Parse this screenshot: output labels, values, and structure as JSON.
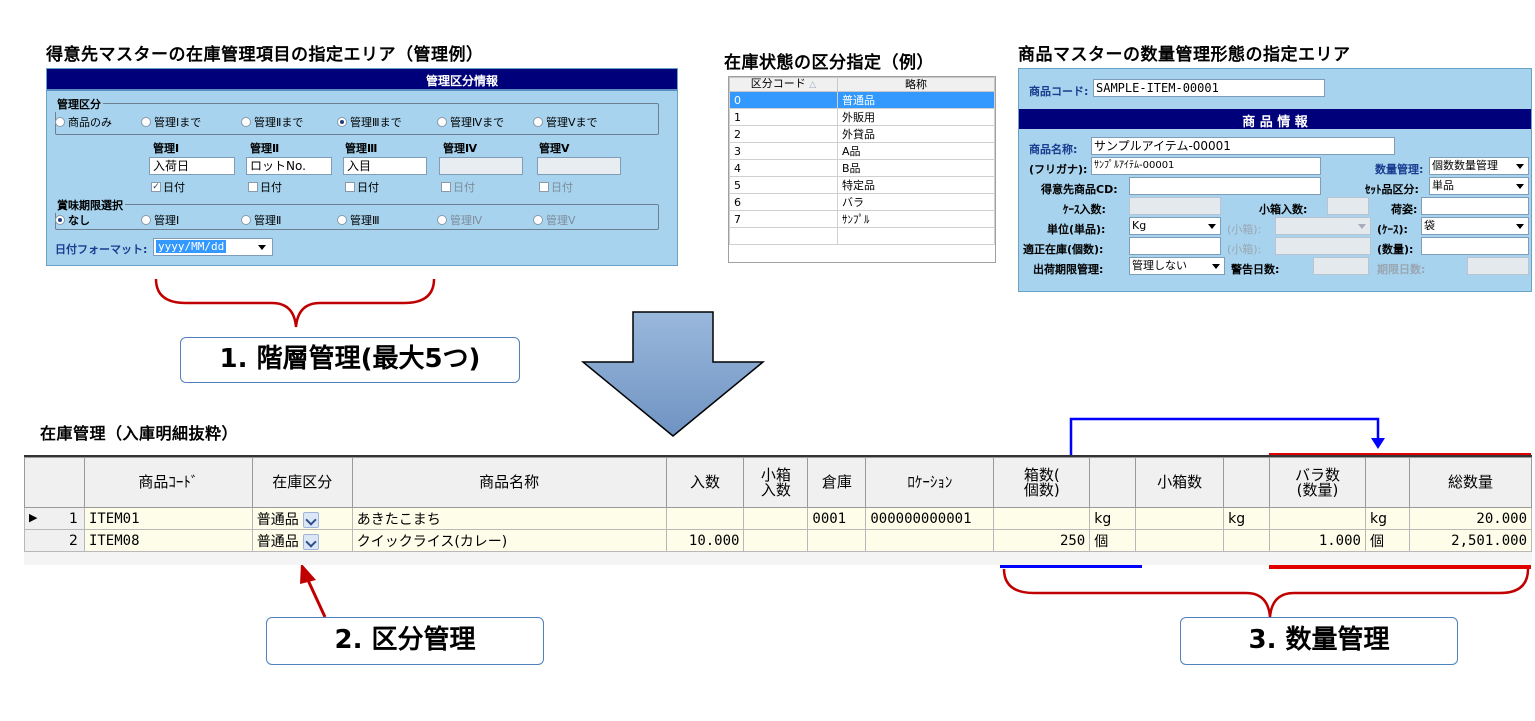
{
  "headings": {
    "customer_master": "得意先マスターの在庫管理項目の指定エリア（管理例）",
    "stock_status": "在庫状態の区分指定（例）",
    "item_master": "商品マスターの数量管理形態の指定エリア",
    "inventory": "在庫管理（入庫明細抜粋）"
  },
  "customer_panel": {
    "title": "管理区分情報",
    "group_label": "管理区分",
    "radios": [
      "商品のみ",
      "管理Ⅰまで",
      "管理Ⅱまで",
      "管理Ⅲまで",
      "管理Ⅳまで",
      "管理Ⅴまで"
    ],
    "selected_radio": "管理Ⅲまで",
    "levels": [
      {
        "header": "管理Ⅰ",
        "value": "入荷日",
        "check": "日付",
        "checked": true
      },
      {
        "header": "管理Ⅱ",
        "value": "ロットNo.",
        "check": "日付",
        "checked": false
      },
      {
        "header": "管理Ⅲ",
        "value": "入目",
        "check": "日付",
        "checked": false
      },
      {
        "header": "管理Ⅳ",
        "value": "",
        "check": "日付",
        "checked": false
      },
      {
        "header": "管理Ⅴ",
        "value": "",
        "check": "日付",
        "checked": false
      }
    ],
    "expiry_group_label": "賞味期限選択",
    "expiry_radios": [
      "なし",
      "管理Ⅰ",
      "管理Ⅱ",
      "管理Ⅲ",
      "管理Ⅳ",
      "管理Ⅴ"
    ],
    "expiry_selected": "なし",
    "date_format_label": "日付フォーマット:",
    "date_format_value": "yyyy/MM/dd"
  },
  "stock_status_table": {
    "headers": [
      "区分コード",
      "略称"
    ],
    "rows": [
      {
        "code": "0",
        "name": "普通品"
      },
      {
        "code": "1",
        "name": "外販用"
      },
      {
        "code": "2",
        "name": "外貸品"
      },
      {
        "code": "3",
        "name": "A品"
      },
      {
        "code": "4",
        "name": "B品"
      },
      {
        "code": "5",
        "name": "特定品"
      },
      {
        "code": "6",
        "name": "バラ"
      },
      {
        "code": "7",
        "name": "ｻﾝﾌﾟﾙ"
      }
    ],
    "selected_row": "0"
  },
  "item_panel": {
    "code_label": "商品コード:",
    "code_value": "SAMPLE-ITEM-00001",
    "section_title": "商 品 情 報",
    "name_label": "商品名称:",
    "name_value": "サンプルアイテム-00001",
    "kana_label": "(フリガナ):",
    "kana_value": "ｻﾝﾌﾟﾙｱｲﾃﾑ-00001",
    "qty_mgmt_label": "数量管理:",
    "qty_mgmt_value": "個数数量管理",
    "cust_item_cd_label": "得意先商品CD:",
    "set_kbn_label": "ｾｯﾄ品区分:",
    "set_kbn_value": "単品",
    "case_qty_label": "ｹｰｽ入数:",
    "small_box_qty_label": "小箱入数:",
    "packing_label": "荷姿:",
    "unit_single_label": "単位(単品):",
    "unit_single_value": "Kg",
    "unit_small_box_label": "(小箱):",
    "unit_case_label": "(ｹｰｽ):",
    "unit_case_value": "袋",
    "proper_stock_label": "適正在庫(個数):",
    "proper_small_label": "(小箱):",
    "proper_qty_label": "(数量):",
    "shipping_limit_label": "出荷期限管理:",
    "shipping_limit_value": "管理しない",
    "warning_days_label": "警告日数:",
    "limit_days_label": "期限日数:"
  },
  "callouts": {
    "one": "1. 階層管理(最大5つ)",
    "two": "2. 区分管理",
    "three": "3. 数量管理"
  },
  "inventory_grid": {
    "headers": [
      "",
      "商品ｺｰﾄﾞ",
      "在庫区分",
      "商品名称",
      "入数",
      "小箱\n入数",
      "倉庫",
      "ﾛｹｰｼｮﾝ",
      "箱数(\n個数)",
      "",
      "小箱数",
      "",
      "バラ数\n(数量)",
      "",
      "総数量"
    ],
    "rows": [
      {
        "no": "1",
        "current": true,
        "code": "ITEM01",
        "kbn": "普通品",
        "name": "あきたこまち",
        "irisu": "",
        "kobako_irisu": "",
        "soko": "0001",
        "loc": "000000000001",
        "hako": "",
        "hako_unit": "kg",
        "kobako": "",
        "kobako_unit": "kg",
        "bara": "",
        "bara_unit": "kg",
        "total": "20.000"
      },
      {
        "no": "2",
        "current": false,
        "code": "ITEM08",
        "kbn": "普通品",
        "name": "クイックライス(カレー)",
        "irisu": "10.000",
        "kobako_irisu": "",
        "soko": "",
        "loc": "",
        "hako": "250",
        "hako_unit": "個",
        "kobako": "",
        "kobako_unit": "",
        "bara": "1.000",
        "bara_unit": "個",
        "total": "2,501.000"
      }
    ]
  },
  "colors": {
    "panel_bg": "#a7d3ee",
    "panel_title_bg": "#00007a",
    "selection": "#3399ff",
    "annotation_red": "#c00000",
    "annotation_blue": "#0000ff",
    "callout_border": "#4f81bd"
  }
}
